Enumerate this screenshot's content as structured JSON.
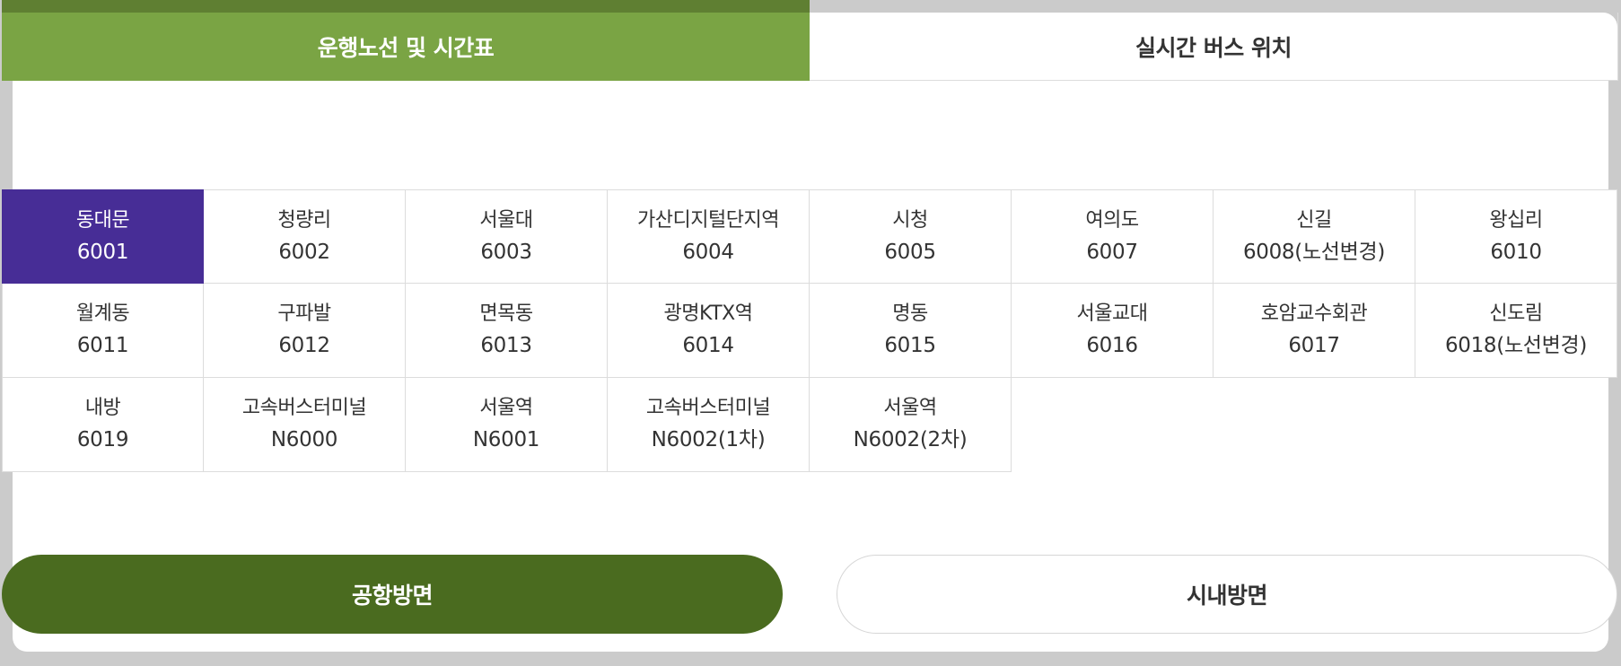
{
  "tabs": {
    "active_label": "운행노선 및 시간표",
    "inactive_label": "실시간 버스 위치"
  },
  "routes": [
    {
      "name": "동대문",
      "number": "6001",
      "selected": true
    },
    {
      "name": "청량리",
      "number": "6002",
      "selected": false
    },
    {
      "name": "서울대",
      "number": "6003",
      "selected": false
    },
    {
      "name": "가산디지털단지역",
      "number": "6004",
      "selected": false
    },
    {
      "name": "시청",
      "number": "6005",
      "selected": false
    },
    {
      "name": "여의도",
      "number": "6007",
      "selected": false
    },
    {
      "name": "신길",
      "number": "6008(노선변경)",
      "selected": false
    },
    {
      "name": "왕십리",
      "number": "6010",
      "selected": false
    },
    {
      "name": "월계동",
      "number": "6011",
      "selected": false
    },
    {
      "name": "구파발",
      "number": "6012",
      "selected": false
    },
    {
      "name": "면목동",
      "number": "6013",
      "selected": false
    },
    {
      "name": "광명KTX역",
      "number": "6014",
      "selected": false
    },
    {
      "name": "명동",
      "number": "6015",
      "selected": false
    },
    {
      "name": "서울교대",
      "number": "6016",
      "selected": false
    },
    {
      "name": "호암교수회관",
      "number": "6017",
      "selected": false
    },
    {
      "name": "신도림",
      "number": "6018(노선변경)",
      "selected": false
    },
    {
      "name": "내방",
      "number": "6019",
      "selected": false
    },
    {
      "name": "고속버스터미널",
      "number": "N6000",
      "selected": false
    },
    {
      "name": "서울역",
      "number": "N6001",
      "selected": false
    },
    {
      "name": "고속버스터미널",
      "number": "N6002(1차)",
      "selected": false
    },
    {
      "name": "서울역",
      "number": "N6002(2차)",
      "selected": false
    }
  ],
  "directions": {
    "active_label": "공항방면",
    "inactive_label": "시내방면"
  },
  "colors": {
    "tab_active": "#7aa444",
    "selected_route": "#472d96",
    "direction_active": "#4a6b1f"
  }
}
